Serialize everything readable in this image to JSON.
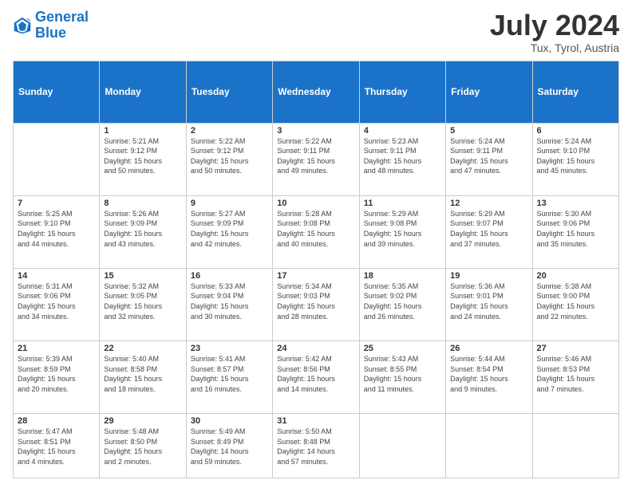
{
  "header": {
    "logo_line1": "General",
    "logo_line2": "Blue",
    "month": "July 2024",
    "location": "Tux, Tyrol, Austria"
  },
  "weekdays": [
    "Sunday",
    "Monday",
    "Tuesday",
    "Wednesday",
    "Thursday",
    "Friday",
    "Saturday"
  ],
  "weeks": [
    [
      {
        "num": "",
        "info": ""
      },
      {
        "num": "1",
        "info": "Sunrise: 5:21 AM\nSunset: 9:12 PM\nDaylight: 15 hours\nand 50 minutes."
      },
      {
        "num": "2",
        "info": "Sunrise: 5:22 AM\nSunset: 9:12 PM\nDaylight: 15 hours\nand 50 minutes."
      },
      {
        "num": "3",
        "info": "Sunrise: 5:22 AM\nSunset: 9:11 PM\nDaylight: 15 hours\nand 49 minutes."
      },
      {
        "num": "4",
        "info": "Sunrise: 5:23 AM\nSunset: 9:11 PM\nDaylight: 15 hours\nand 48 minutes."
      },
      {
        "num": "5",
        "info": "Sunrise: 5:24 AM\nSunset: 9:11 PM\nDaylight: 15 hours\nand 47 minutes."
      },
      {
        "num": "6",
        "info": "Sunrise: 5:24 AM\nSunset: 9:10 PM\nDaylight: 15 hours\nand 45 minutes."
      }
    ],
    [
      {
        "num": "7",
        "info": "Sunrise: 5:25 AM\nSunset: 9:10 PM\nDaylight: 15 hours\nand 44 minutes."
      },
      {
        "num": "8",
        "info": "Sunrise: 5:26 AM\nSunset: 9:09 PM\nDaylight: 15 hours\nand 43 minutes."
      },
      {
        "num": "9",
        "info": "Sunrise: 5:27 AM\nSunset: 9:09 PM\nDaylight: 15 hours\nand 42 minutes."
      },
      {
        "num": "10",
        "info": "Sunrise: 5:28 AM\nSunset: 9:08 PM\nDaylight: 15 hours\nand 40 minutes."
      },
      {
        "num": "11",
        "info": "Sunrise: 5:29 AM\nSunset: 9:08 PM\nDaylight: 15 hours\nand 39 minutes."
      },
      {
        "num": "12",
        "info": "Sunrise: 5:29 AM\nSunset: 9:07 PM\nDaylight: 15 hours\nand 37 minutes."
      },
      {
        "num": "13",
        "info": "Sunrise: 5:30 AM\nSunset: 9:06 PM\nDaylight: 15 hours\nand 35 minutes."
      }
    ],
    [
      {
        "num": "14",
        "info": "Sunrise: 5:31 AM\nSunset: 9:06 PM\nDaylight: 15 hours\nand 34 minutes."
      },
      {
        "num": "15",
        "info": "Sunrise: 5:32 AM\nSunset: 9:05 PM\nDaylight: 15 hours\nand 32 minutes."
      },
      {
        "num": "16",
        "info": "Sunrise: 5:33 AM\nSunset: 9:04 PM\nDaylight: 15 hours\nand 30 minutes."
      },
      {
        "num": "17",
        "info": "Sunrise: 5:34 AM\nSunset: 9:03 PM\nDaylight: 15 hours\nand 28 minutes."
      },
      {
        "num": "18",
        "info": "Sunrise: 5:35 AM\nSunset: 9:02 PM\nDaylight: 15 hours\nand 26 minutes."
      },
      {
        "num": "19",
        "info": "Sunrise: 5:36 AM\nSunset: 9:01 PM\nDaylight: 15 hours\nand 24 minutes."
      },
      {
        "num": "20",
        "info": "Sunrise: 5:38 AM\nSunset: 9:00 PM\nDaylight: 15 hours\nand 22 minutes."
      }
    ],
    [
      {
        "num": "21",
        "info": "Sunrise: 5:39 AM\nSunset: 8:59 PM\nDaylight: 15 hours\nand 20 minutes."
      },
      {
        "num": "22",
        "info": "Sunrise: 5:40 AM\nSunset: 8:58 PM\nDaylight: 15 hours\nand 18 minutes."
      },
      {
        "num": "23",
        "info": "Sunrise: 5:41 AM\nSunset: 8:57 PM\nDaylight: 15 hours\nand 16 minutes."
      },
      {
        "num": "24",
        "info": "Sunrise: 5:42 AM\nSunset: 8:56 PM\nDaylight: 15 hours\nand 14 minutes."
      },
      {
        "num": "25",
        "info": "Sunrise: 5:43 AM\nSunset: 8:55 PM\nDaylight: 15 hours\nand 11 minutes."
      },
      {
        "num": "26",
        "info": "Sunrise: 5:44 AM\nSunset: 8:54 PM\nDaylight: 15 hours\nand 9 minutes."
      },
      {
        "num": "27",
        "info": "Sunrise: 5:46 AM\nSunset: 8:53 PM\nDaylight: 15 hours\nand 7 minutes."
      }
    ],
    [
      {
        "num": "28",
        "info": "Sunrise: 5:47 AM\nSunset: 8:51 PM\nDaylight: 15 hours\nand 4 minutes."
      },
      {
        "num": "29",
        "info": "Sunrise: 5:48 AM\nSunset: 8:50 PM\nDaylight: 15 hours\nand 2 minutes."
      },
      {
        "num": "30",
        "info": "Sunrise: 5:49 AM\nSunset: 8:49 PM\nDaylight: 14 hours\nand 59 minutes."
      },
      {
        "num": "31",
        "info": "Sunrise: 5:50 AM\nSunset: 8:48 PM\nDaylight: 14 hours\nand 57 minutes."
      },
      {
        "num": "",
        "info": ""
      },
      {
        "num": "",
        "info": ""
      },
      {
        "num": "",
        "info": ""
      }
    ]
  ]
}
